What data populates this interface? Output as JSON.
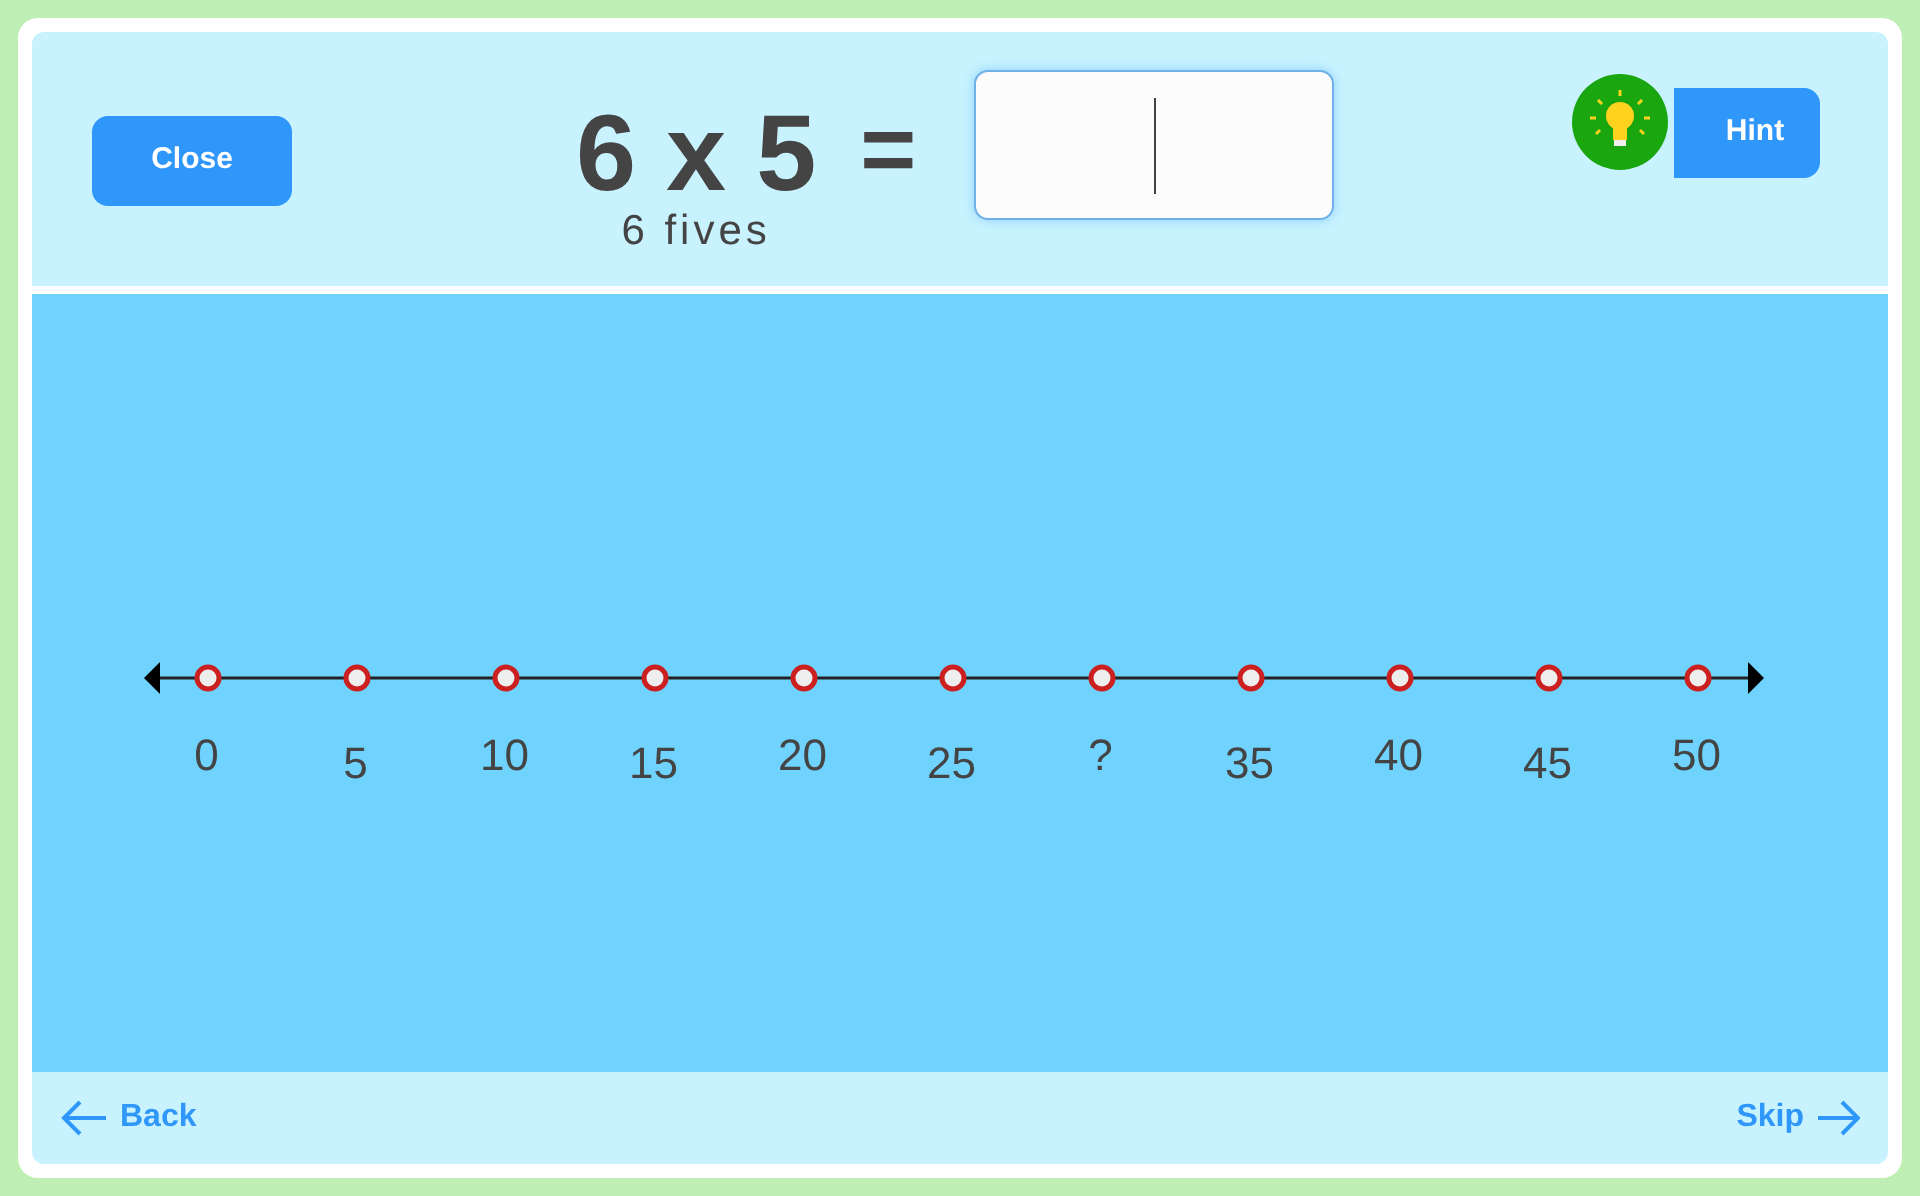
{
  "close_button": "Close",
  "question": {
    "equation": "6 x 5",
    "equals": "=",
    "hint_text": "6 fives"
  },
  "hint_button": "Hint",
  "number_line": {
    "labels": [
      "0",
      "5",
      "10",
      "15",
      "20",
      "25",
      "?",
      "35",
      "40",
      "45",
      "50"
    ]
  },
  "footer": {
    "back": "Back",
    "skip": "Skip"
  }
}
